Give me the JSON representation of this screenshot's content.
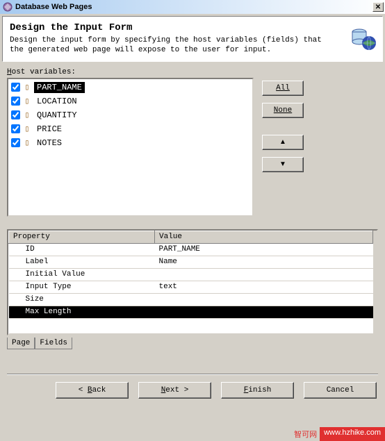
{
  "window": {
    "title": "Database Web Pages"
  },
  "header": {
    "title": "Design the Input Form",
    "description": "Design the input form by specifying the host variables (fields) that the generated web page will expose to the user for input."
  },
  "hostVarsLabel": "Host variables:",
  "hostVars": [
    {
      "name": "PART_NAME",
      "checked": true,
      "selected": true
    },
    {
      "name": "LOCATION",
      "checked": true,
      "selected": false
    },
    {
      "name": "QUANTITY",
      "checked": true,
      "selected": false
    },
    {
      "name": "PRICE",
      "checked": true,
      "selected": false
    },
    {
      "name": "NOTES",
      "checked": true,
      "selected": false
    }
  ],
  "sideButtons": {
    "all": "All",
    "none": "None"
  },
  "propsHeader": {
    "col1": "Property",
    "col2": "Value"
  },
  "properties": [
    {
      "name": "ID",
      "value": "PART_NAME",
      "selected": false
    },
    {
      "name": "Label",
      "value": "Name",
      "selected": false
    },
    {
      "name": "Initial Value",
      "value": "",
      "selected": false
    },
    {
      "name": "Input Type",
      "value": "text",
      "selected": false
    },
    {
      "name": "Size",
      "value": "",
      "selected": false
    },
    {
      "name": "Max Length",
      "value": "",
      "selected": true
    }
  ],
  "tabs": {
    "page": "Page",
    "fields": "Fields"
  },
  "footerButtons": {
    "back": "Back",
    "next": "Next",
    "finish": "Finish",
    "cancel": "Cancel"
  },
  "watermark": {
    "text1": "智可网",
    "text2": "www.hzhike.com"
  }
}
